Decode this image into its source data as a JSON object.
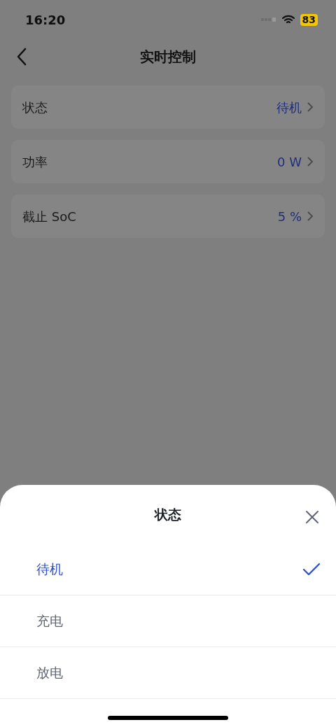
{
  "status_bar": {
    "time": "16:20",
    "battery": "83"
  },
  "nav": {
    "title": "实时控制"
  },
  "settings": [
    {
      "label": "状态",
      "value": "待机"
    },
    {
      "label": "功率",
      "value": "0 W"
    },
    {
      "label": "截止 SoC",
      "value": "5 %"
    }
  ],
  "sheet": {
    "title": "状态",
    "options": [
      {
        "label": "待机",
        "selected": true
      },
      {
        "label": "充电",
        "selected": false
      },
      {
        "label": "放电",
        "selected": false
      }
    ]
  }
}
